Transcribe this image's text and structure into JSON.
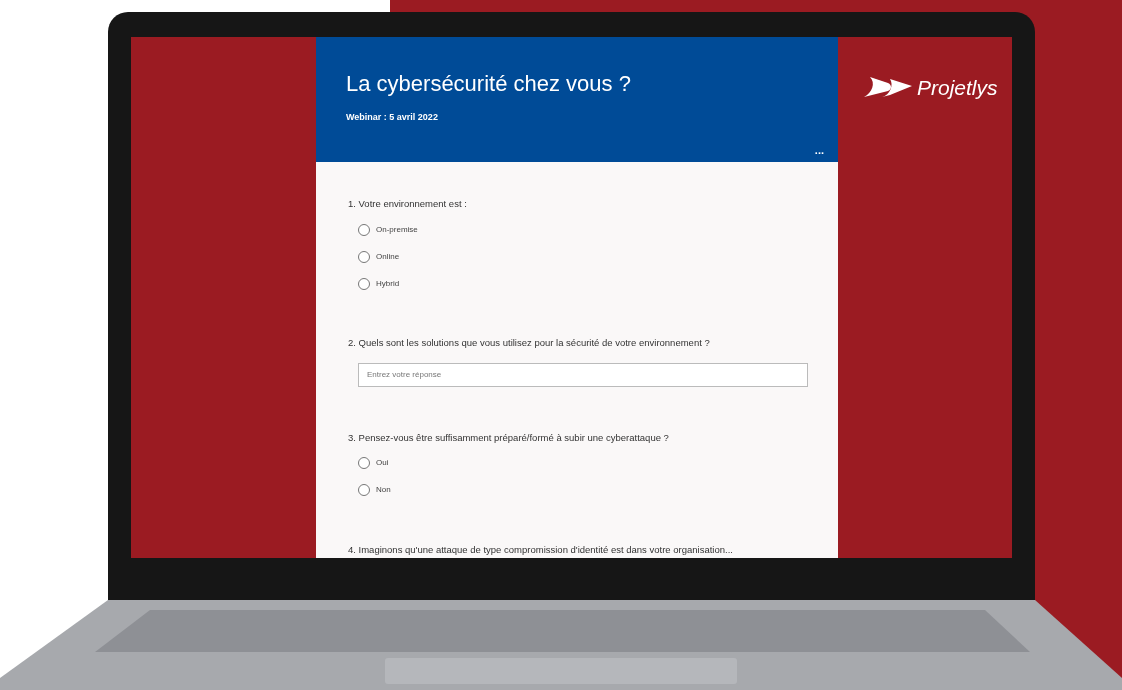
{
  "brand": {
    "name": "Projetlys"
  },
  "form": {
    "title": "La cybersécurité chez vous ?",
    "subtitle": "Webinar : 5 avril 2022",
    "menu": "...",
    "questions": [
      {
        "kind": "choice",
        "label": "1. Votre environnement est :",
        "options": [
          {
            "label": "On-premise",
            "selected": false
          },
          {
            "label": "Online",
            "selected": false
          },
          {
            "label": "Hybrid",
            "selected": false
          }
        ]
      },
      {
        "kind": "text",
        "label": "2. Quels sont les solutions que vous utilisez pour la sécurité de votre environnement ?",
        "placeholder": "Entrez votre réponse"
      },
      {
        "kind": "choice",
        "label": "3. Pensez-vous être suffisamment préparé/formé à subir une cyberattaque ?",
        "options": [
          {
            "label": "Oui",
            "selected": false
          },
          {
            "label": "Non",
            "selected": false
          }
        ]
      },
      {
        "kind": "heading",
        "label": "4. Imaginons qu'une attaque de type compromission d'identité est dans votre organisation..."
      }
    ]
  }
}
